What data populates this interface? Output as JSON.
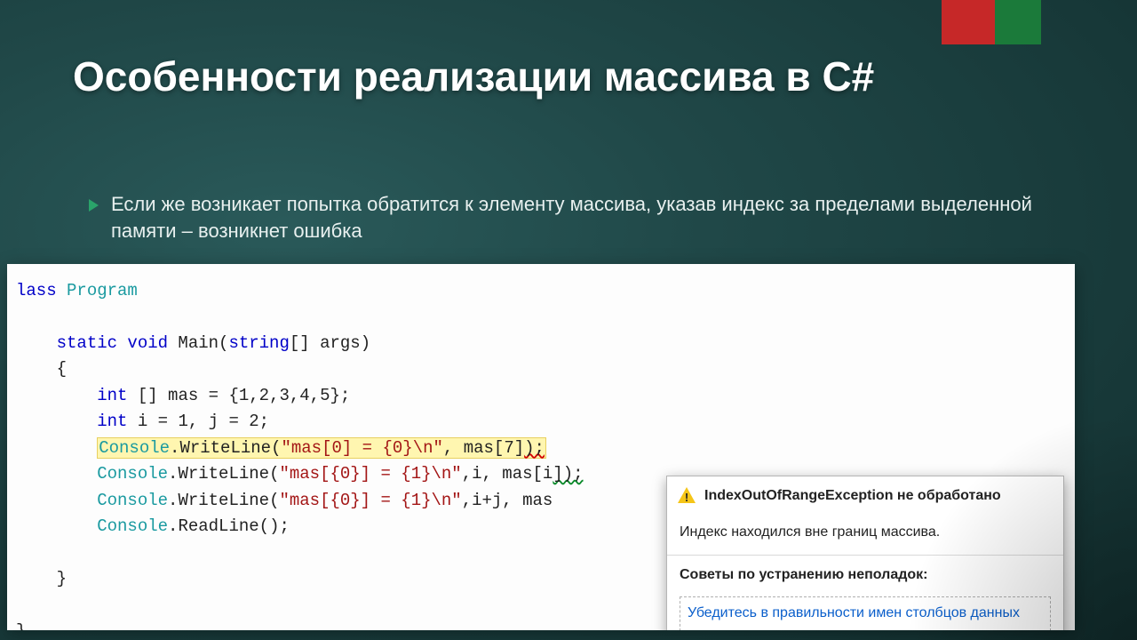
{
  "title": "Особенности реализации массива в С#",
  "bullet": "Если же возникает попытка обратится к элементу массива, указав индекс за пределами выделенной памяти – возникнет ошибка",
  "code": {
    "l1a": "lass ",
    "l1b": "Program",
    "l2a": "static void",
    "l2b": " Main(",
    "l2c": "string",
    "l2d": "[] args)",
    "l3": "{",
    "l4a": "int",
    "l4b": " [] mas = {1,2,3,4,5};",
    "l5a": "int",
    "l5b": " i = 1, j = 2;",
    "l6a": "Console",
    "l6b": ".WriteLine(",
    "l6c": "\"mas[0] = {0}\\n\"",
    "l6d": ", mas[7]",
    "l6e": ");",
    "l7a": "Console",
    "l7b": ".WriteLine(",
    "l7c": "\"mas[{0}] = {1}\\n\"",
    "l7d": ",i, mas[i",
    "l7e": "]);",
    "l8a": "Console",
    "l8b": ".WriteLine(",
    "l8c": "\"mas[{0}] = {1}\\n\"",
    "l8d": ",i+j, mas",
    "l9a": "Console",
    "l9b": ".ReadLine();",
    "l10": "}",
    "l11": "}"
  },
  "tooltip": {
    "head": "IndexOutOfRangeException не обработано",
    "message": "Индекс находился вне границ массива.",
    "subhead": "Советы по устранению неполадок:",
    "link": "Убедитесь в правильности имен столбцов данных"
  }
}
